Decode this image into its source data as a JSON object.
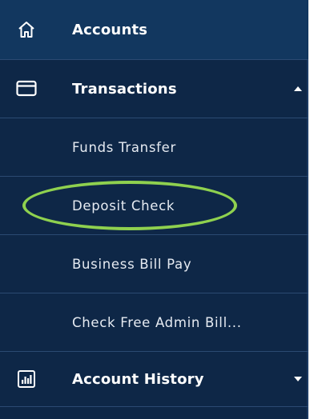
{
  "nav": {
    "accounts": {
      "label": "Accounts",
      "icon": "home-icon"
    },
    "transactions": {
      "label": "Transactions",
      "icon": "card-icon",
      "expanded": true,
      "items": [
        {
          "label": "Funds Transfer"
        },
        {
          "label": "Deposit Check"
        },
        {
          "label": "Business Bill Pay"
        },
        {
          "label": "Check Free Admin Bill..."
        }
      ]
    },
    "account_history": {
      "label": "Account History",
      "icon": "bar-chart-icon",
      "expanded": false
    }
  },
  "colors": {
    "background": "#0e2747",
    "divider": "#2b4a72",
    "highlight": "#8fd14f"
  }
}
